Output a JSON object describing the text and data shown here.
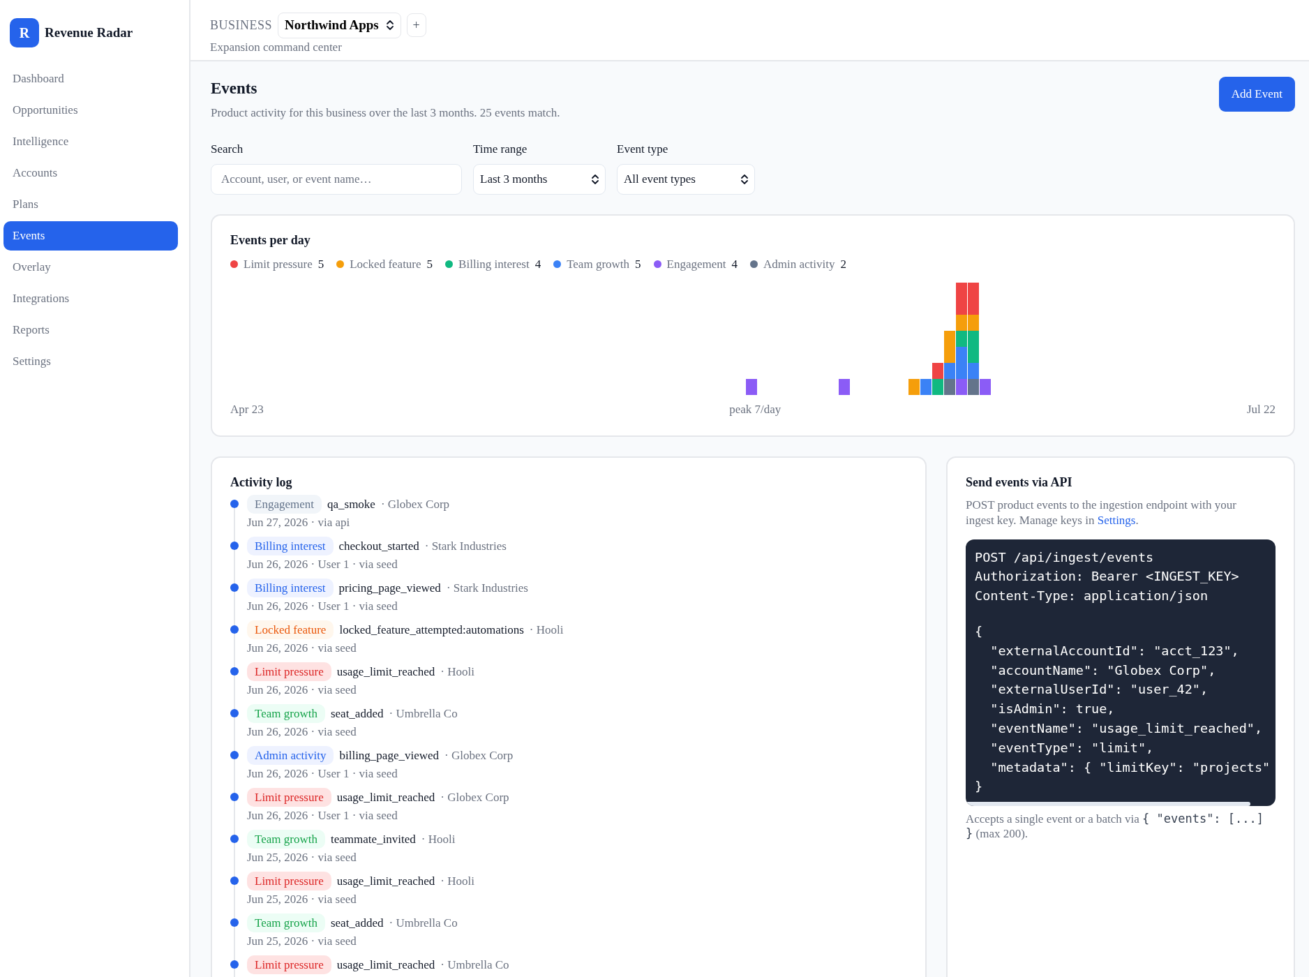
{
  "brand": {
    "logo": "R",
    "name": "Revenue Radar"
  },
  "sidebar": {
    "items": [
      {
        "label": "Dashboard",
        "selected": false
      },
      {
        "label": "Opportunities",
        "selected": false
      },
      {
        "label": "Intelligence",
        "selected": false
      },
      {
        "label": "Accounts",
        "selected": false
      },
      {
        "label": "Plans",
        "selected": false
      },
      {
        "label": "Events",
        "selected": true
      },
      {
        "label": "Overlay",
        "selected": false
      },
      {
        "label": "Integrations",
        "selected": false
      },
      {
        "label": "Reports",
        "selected": false
      },
      {
        "label": "Settings",
        "selected": false
      }
    ]
  },
  "header": {
    "label": "BUSINESS",
    "business": "Northwind Apps",
    "add": "+",
    "subtitle": "Expansion command center"
  },
  "page": {
    "title": "Events",
    "subtitle": "Product activity for this business over the last 3 months. 25 events match.",
    "add_button": "Add Event"
  },
  "filters": {
    "search": {
      "label": "Search",
      "placeholder": "Account, user, or event name…"
    },
    "time_range": {
      "label": "Time range",
      "value": "Last 3 months"
    },
    "event_type": {
      "label": "Event type",
      "value": "All event types"
    }
  },
  "events_chart": {
    "title": "Events per day",
    "legend": [
      {
        "label": "Limit pressure",
        "count": "5",
        "color": "#ef4444"
      },
      {
        "label": "Locked feature",
        "count": "5",
        "color": "#f59e0b"
      },
      {
        "label": "Billing interest",
        "count": "4",
        "color": "#10b981"
      },
      {
        "label": "Team growth",
        "count": "5",
        "color": "#3b82f6"
      },
      {
        "label": "Engagement",
        "count": "4",
        "color": "#8b5cf6"
      },
      {
        "label": "Admin activity",
        "count": "2",
        "color": "#64748b"
      }
    ],
    "start_label": "Apr 23",
    "peak_label": "peak 7/day",
    "end_label": "Jul 22"
  },
  "activity_log": {
    "title": "Activity log",
    "items": [
      {
        "tag": "Engagement",
        "kind": "engagement",
        "event": "qa_smoke",
        "account": "· Globex Corp",
        "meta": "Jun 27, 2026 · via api"
      },
      {
        "tag": "Billing interest",
        "kind": "billing",
        "event": "checkout_started",
        "account": "· Stark Industries",
        "meta": "Jun 26, 2026 · User 1 · via seed"
      },
      {
        "tag": "Billing interest",
        "kind": "billing",
        "event": "pricing_page_viewed",
        "account": "· Stark Industries",
        "meta": "Jun 26, 2026 · User 1 · via seed"
      },
      {
        "tag": "Locked feature",
        "kind": "locked",
        "event": "locked_feature_attempted:automations",
        "account": "· Hooli",
        "meta": "Jun 26, 2026 · via seed"
      },
      {
        "tag": "Limit pressure",
        "kind": "limit",
        "event": "usage_limit_reached",
        "account": "· Hooli",
        "meta": "Jun 26, 2026 · via seed"
      },
      {
        "tag": "Team growth",
        "kind": "team",
        "event": "seat_added",
        "account": "· Umbrella Co",
        "meta": "Jun 26, 2026 · via seed"
      },
      {
        "tag": "Admin activity",
        "kind": "admin",
        "event": "billing_page_viewed",
        "account": "· Globex Corp",
        "meta": "Jun 26, 2026 · User 1 · via seed"
      },
      {
        "tag": "Limit pressure",
        "kind": "limit",
        "event": "usage_limit_reached",
        "account": "· Globex Corp",
        "meta": "Jun 26, 2026 · User 1 · via seed"
      },
      {
        "tag": "Team growth",
        "kind": "team",
        "event": "teammate_invited",
        "account": "· Hooli",
        "meta": "Jun 25, 2026 · via seed"
      },
      {
        "tag": "Limit pressure",
        "kind": "limit",
        "event": "usage_limit_reached",
        "account": "· Hooli",
        "meta": "Jun 25, 2026 · via seed"
      },
      {
        "tag": "Team growth",
        "kind": "team",
        "event": "seat_added",
        "account": "· Umbrella Co",
        "meta": "Jun 25, 2026 · via seed"
      },
      {
        "tag": "Limit pressure",
        "kind": "limit",
        "event": "usage_limit_reached",
        "account": "· Umbrella Co"
      }
    ]
  },
  "api": {
    "title": "Send events via API",
    "description": "POST product events to the ingestion endpoint with your ingest key. Manage keys in",
    "link": "Settings",
    "description_end": ".",
    "code_headers": [
      "POST /api/ingest/events",
      "Authorization: Bearer <INGEST_KEY>",
      "Content-Type: application/json"
    ],
    "code_body": [
      "{",
      "  \"externalAccountId\": \"acct_123\",",
      "  \"accountName\": \"Globex Corp\",",
      "  \"externalUserId\": \"user_42\",",
      "  \"isAdmin\": true,",
      "  \"eventName\": \"usage_limit_reached\",",
      "  \"eventType\": \"limit\",",
      "  \"metadata\": { \"limitKey\": \"projects\"",
      "}"
    ],
    "note_start": "Accepts a single event or a batch via",
    "note_code": "{ \"events\": [...] }",
    "note_end": "(max 200)."
  }
}
